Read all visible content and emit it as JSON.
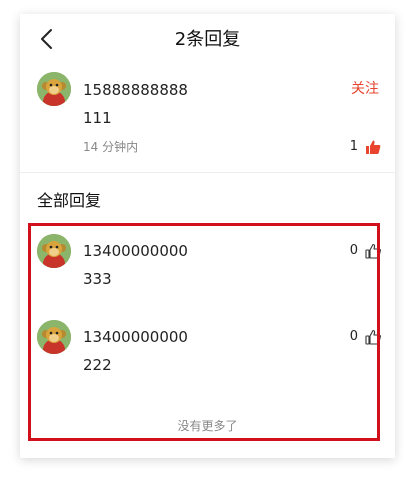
{
  "nav": {
    "title": "2条回复"
  },
  "main_comment": {
    "username": "15888888888",
    "text": "111",
    "follow_label": "关注",
    "time": "14 分钟内",
    "like_count": "1"
  },
  "section": {
    "title": "全部回复"
  },
  "replies": [
    {
      "username": "13400000000",
      "text": "333",
      "like_count": "0"
    },
    {
      "username": "13400000000",
      "text": "222",
      "like_count": "0"
    }
  ],
  "footer": {
    "no_more": "没有更多了"
  },
  "colors": {
    "accent": "#e8442e",
    "highlight_border": "#d0101b"
  }
}
